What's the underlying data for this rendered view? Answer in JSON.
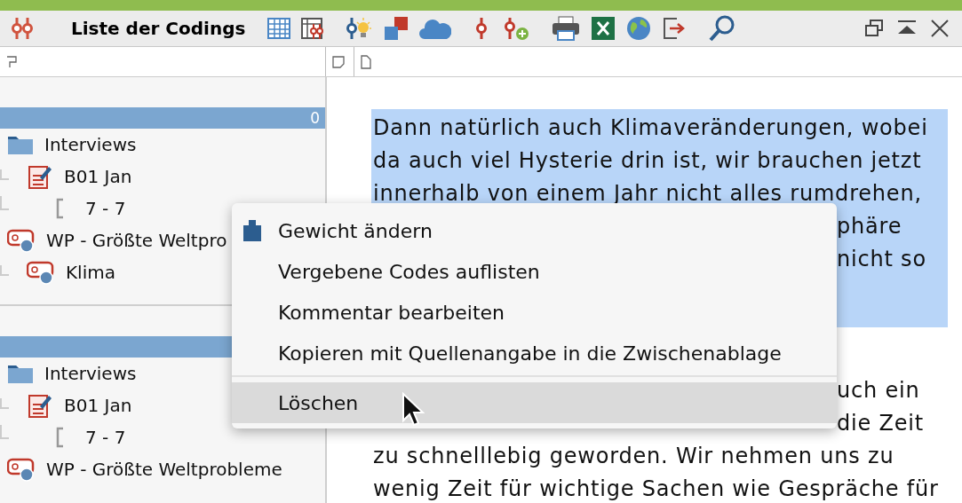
{
  "window": {
    "title": "Liste der Codings"
  },
  "tree_panes": [
    {
      "header_count": "0",
      "items": [
        {
          "label": "Interviews",
          "kind": "folder",
          "children": [
            {
              "label": "B01 Jan",
              "kind": "document",
              "children": [
                {
                  "label": "7 - 7",
                  "kind": "segment"
                }
              ]
            }
          ]
        },
        {
          "label": "WP - Größte Weltpro",
          "kind": "code",
          "children": [
            {
              "label": "Klima",
              "kind": "code"
            }
          ]
        }
      ]
    },
    {
      "items": [
        {
          "label": "Interviews",
          "kind": "folder",
          "children": [
            {
              "label": "B01 Jan",
              "kind": "document",
              "children": [
                {
                  "label": "7 - 7",
                  "kind": "segment"
                }
              ]
            }
          ]
        },
        {
          "label": "WP - Größte Weltprobleme",
          "kind": "code"
        }
      ]
    }
  ],
  "document": {
    "paragraphs": [
      {
        "selected": true,
        "lines": [
          {
            "text": "Dann natürlich auch Klimaveränderungen, wobei",
            "covered": false
          },
          {
            "text": "da auch viel Hysterie drin ist, wir brauchen jetzt",
            "covered": false
          },
          {
            "text": "innerhalb von einem Jahr nicht alles rumdrehen,",
            "covered": false
          },
          {
            "text": "phäre",
            "covered": true
          },
          {
            "text": "nicht so",
            "covered": true
          }
        ]
      },
      {
        "selected": false,
        "lines": [
          {
            "text": "uch ein",
            "covered": true
          },
          {
            "text": "die Zeit",
            "covered": true
          },
          {
            "text": "zu schnelllebig geworden. Wir nehmen uns zu",
            "covered": false
          },
          {
            "text": "wenig Zeit für wichtige Sachen wie Gespräche für",
            "covered": false
          }
        ]
      }
    ]
  },
  "context_menu": {
    "items": [
      {
        "label": "Gewicht ändern",
        "kind": "weight",
        "highlighted": false,
        "separator_before": false
      },
      {
        "label": "Vergebene Codes auflisten",
        "kind": "plain",
        "highlighted": false,
        "separator_before": false
      },
      {
        "label": "Kommentar bearbeiten",
        "kind": "plain",
        "highlighted": false,
        "separator_before": false
      },
      {
        "label": "Kopieren mit Quellenangabe in die Zwischenablage",
        "kind": "plain",
        "highlighted": false,
        "separator_before": false
      },
      {
        "label": "Löschen",
        "kind": "plain",
        "highlighted": true,
        "separator_before": true
      }
    ]
  }
}
